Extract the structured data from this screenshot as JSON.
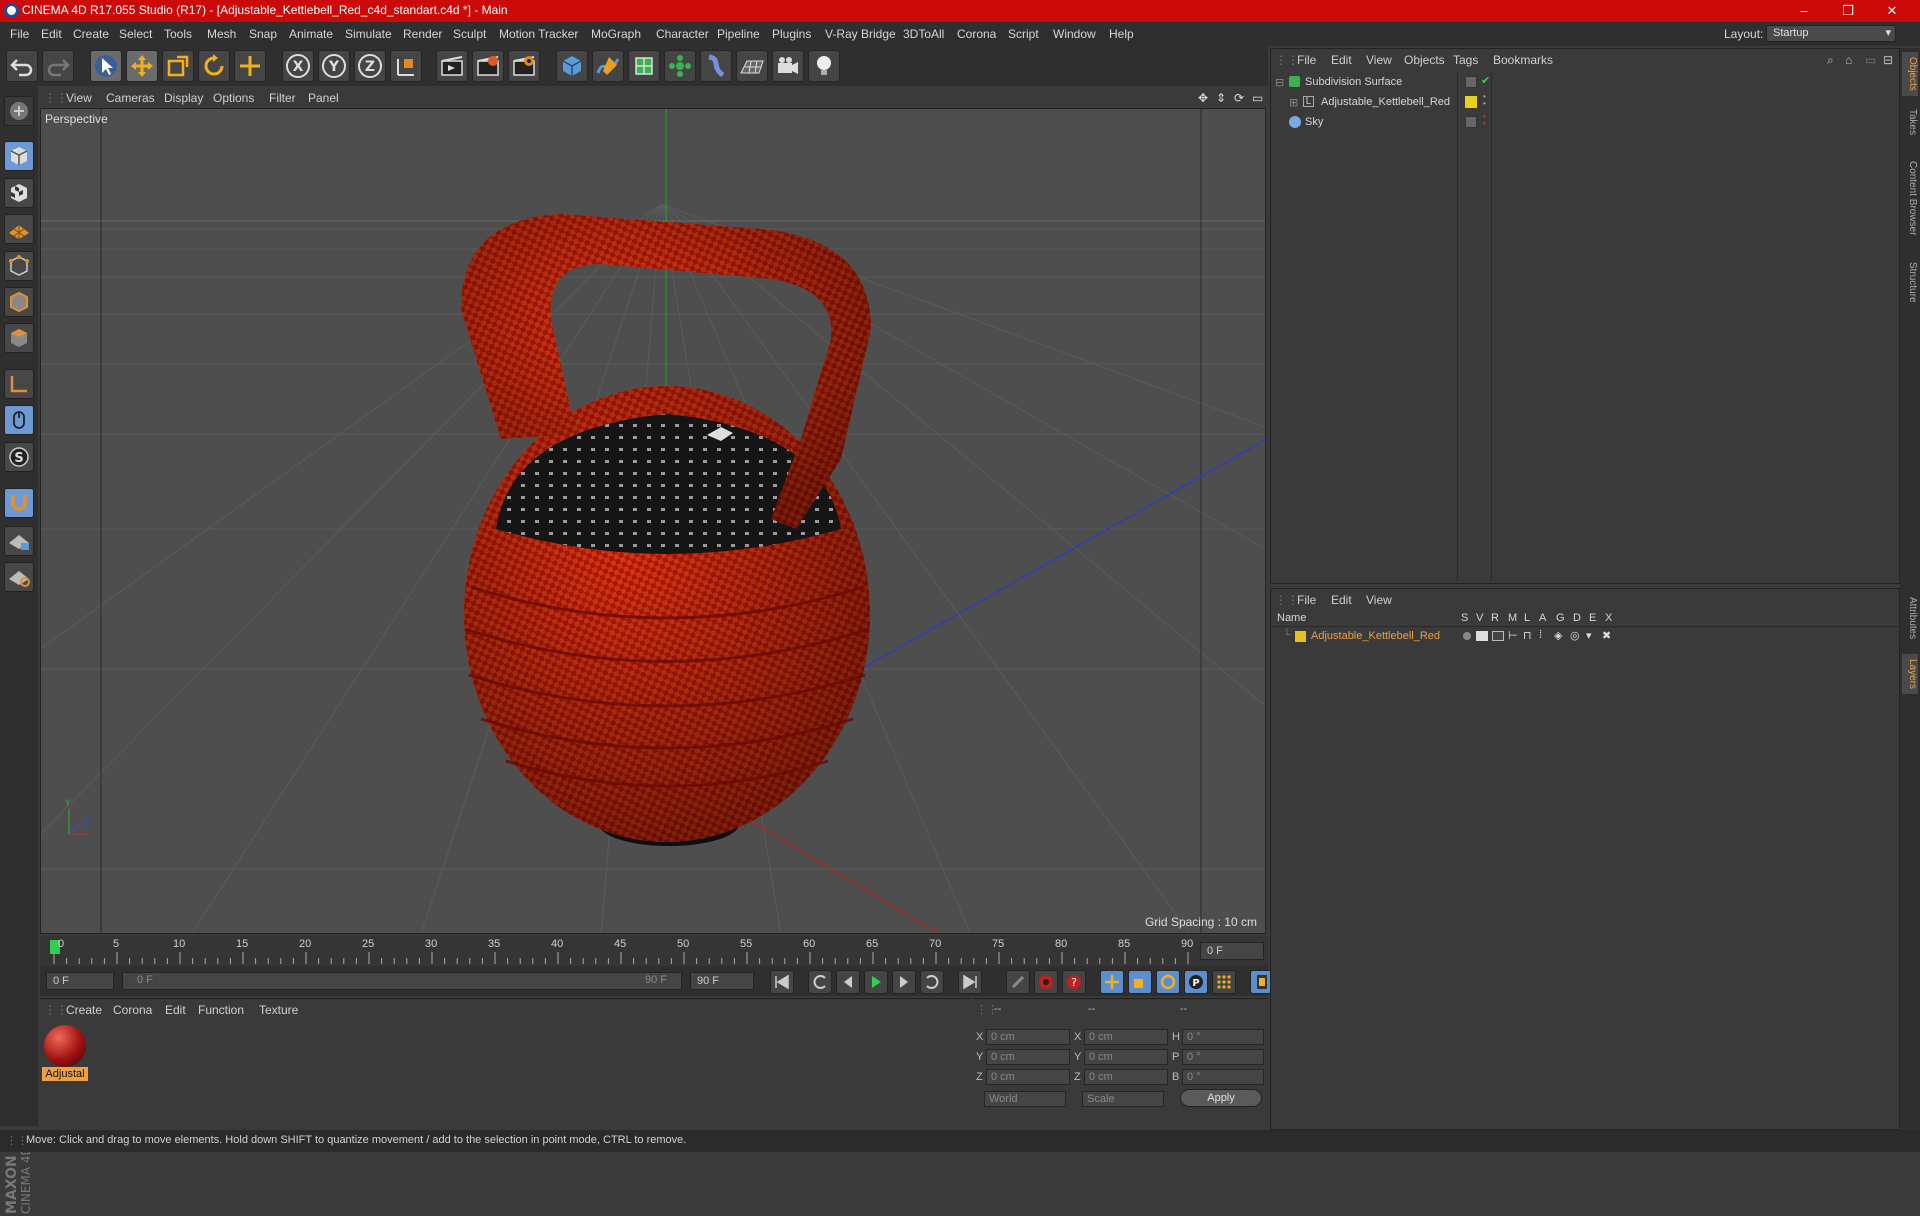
{
  "window": {
    "title": "CINEMA 4D R17.055 Studio (R17) - [Adjustable_Kettlebell_Red_c4d_standart.c4d *] - Main",
    "minimize": "–",
    "maximize": "❐",
    "close": "✕"
  },
  "menu": [
    "File",
    "Edit",
    "Create",
    "Select",
    "Tools",
    "Mesh",
    "Snap",
    "Animate",
    "Simulate",
    "Render",
    "Sculpt",
    "Motion Tracker",
    "MoGraph",
    "Character",
    "Pipeline",
    "Plugins",
    "V-Ray Bridge",
    "3DToAll",
    "Corona",
    "Script",
    "Window",
    "Help"
  ],
  "layout": {
    "label": "Layout:",
    "value": "Startup"
  },
  "viewport": {
    "menu": [
      "View",
      "Cameras",
      "Display",
      "Options",
      "Filter",
      "Panel"
    ],
    "label": "Perspective",
    "grid_spacing": "Grid Spacing : 10 cm"
  },
  "timeline": {
    "ticks": [
      "0",
      "5",
      "10",
      "15",
      "20",
      "25",
      "30",
      "35",
      "40",
      "45",
      "50",
      "55",
      "60",
      "65",
      "70",
      "75",
      "80",
      "85",
      "90"
    ],
    "current_frame": "0 F",
    "start_field": "0 F",
    "range_start": "0 F",
    "range_end": "90 F",
    "end_field": "90 F"
  },
  "material_manager": {
    "menu": [
      "Create",
      "Corona",
      "Edit",
      "Function",
      "Texture"
    ],
    "material_label": "Adjustal"
  },
  "coordinates": {
    "headers": [
      "--",
      "--",
      "--"
    ],
    "rows": [
      {
        "a": "X",
        "av": "0 cm",
        "b": "X",
        "bv": "0 cm",
        "c": "H",
        "cv": "0 °"
      },
      {
        "a": "Y",
        "av": "0 cm",
        "b": "Y",
        "bv": "0 cm",
        "c": "P",
        "cv": "0 °"
      },
      {
        "a": "Z",
        "av": "0 cm",
        "b": "Z",
        "bv": "0 cm",
        "c": "B",
        "cv": "0 °"
      }
    ],
    "space": "World",
    "mode": "Scale",
    "apply": "Apply"
  },
  "object_manager": {
    "menu": [
      "File",
      "Edit",
      "View",
      "Objects",
      "Tags",
      "Bookmarks"
    ],
    "objects": [
      {
        "name": "Subdivision Surface"
      },
      {
        "name": "Adjustable_Kettlebell_Red"
      },
      {
        "name": "Sky"
      }
    ]
  },
  "layer_manager": {
    "menu": [
      "File",
      "Edit",
      "View"
    ],
    "columns": [
      "Name",
      "S",
      "V",
      "R",
      "M",
      "L",
      "A",
      "G",
      "D",
      "E",
      "X"
    ],
    "layers": [
      {
        "name": "Adjustable_Kettlebell_Red",
        "color": "#e8c020"
      }
    ]
  },
  "right_tabs": [
    "Objects",
    "Takes",
    "Content Browser",
    "Structure",
    "Attributes",
    "Layers"
  ],
  "status": "Move: Click and drag to move elements. Hold down SHIFT to quantize movement / add to the selection in point mode, CTRL to remove.",
  "colors": {
    "title_bar": "#cc0a0a",
    "accent": "#f0a040",
    "kettlebell": "#c81a0a"
  }
}
